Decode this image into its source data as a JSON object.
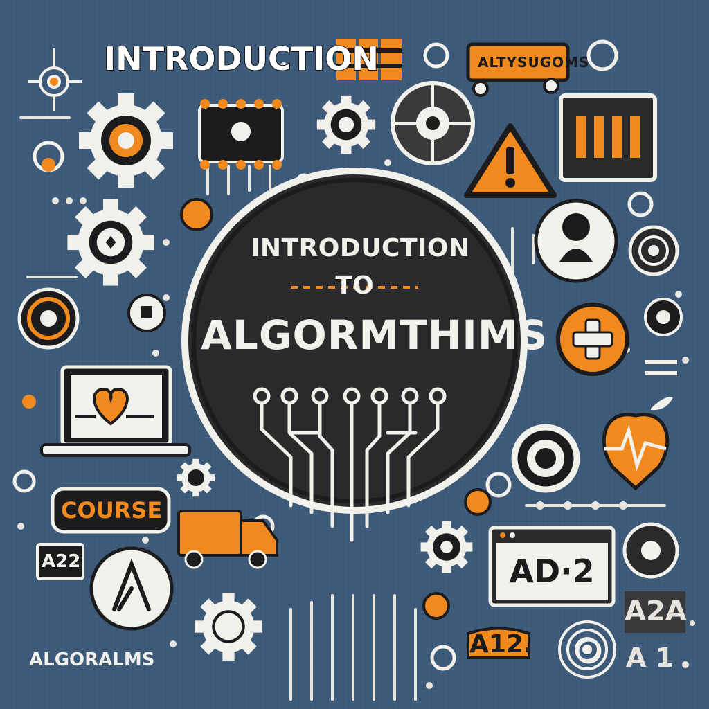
{
  "colors": {
    "background": "#3d5a78",
    "ink": "#1c1c1e",
    "accent": "#f08a1e",
    "light": "#f2f0ea"
  },
  "header": {
    "title": "INTRODUCTION"
  },
  "badges": {
    "top_right": "ALTYSUGOMS",
    "course": "COURSE",
    "a22": "A22",
    "ad2": "AD·2",
    "a2a": "A2A",
    "a21": "A 1",
    "a12": "A12."
  },
  "center_badge": {
    "line1": "INTRODUCTION",
    "line2": "TO",
    "line3": "ALGORMTHIMS"
  },
  "footer": {
    "label": "ALGORALMS"
  },
  "icons": [
    "gear-icon",
    "warning-icon",
    "heart-laptop-icon",
    "truck-icon",
    "apple-heartbeat-icon",
    "plus-icon",
    "chip-icon",
    "battery-icon",
    "target-icon",
    "circuit-icon",
    "lambda-icon"
  ]
}
